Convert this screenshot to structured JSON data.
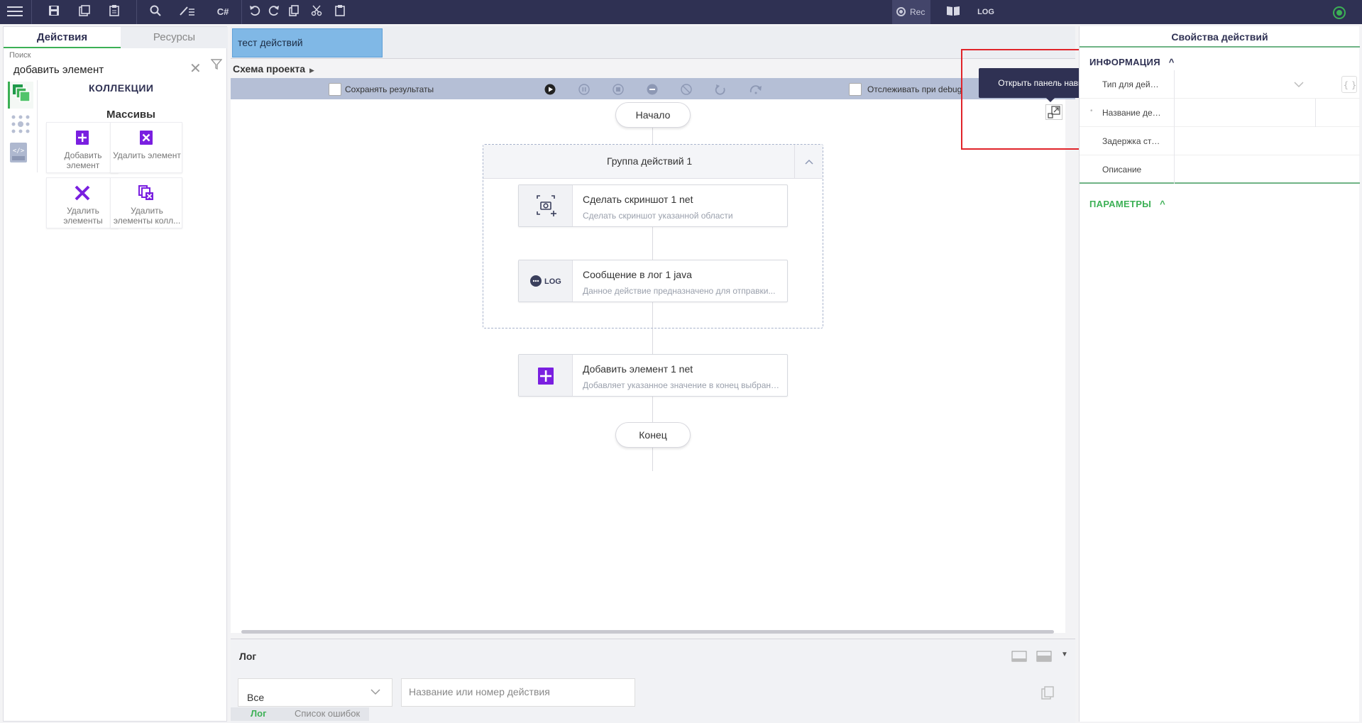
{
  "toolbar": {
    "icons": [
      "menu-icon",
      "save-icon",
      "save-as-icon",
      "clipboard-icon",
      "search-icon",
      "edit-icon",
      "csharp-icon",
      "undo-icon",
      "redo-icon",
      "copy-icon",
      "cut-icon",
      "paste-icon"
    ],
    "csharp_label": "C#",
    "rec_label": "Rec",
    "log_label": "LOG",
    "status_color": "#3cb055"
  },
  "left_panel": {
    "tabs": [
      "Действия",
      "Ресурсы"
    ],
    "search_label": "Поиск",
    "search_value": "добавить элемент",
    "category": "КОЛЛЕКЦИИ",
    "subcategory": "Массивы",
    "actions": [
      {
        "label": "Добавить элемент",
        "icon": "add-element-icon"
      },
      {
        "label": "Удалить элемент",
        "icon": "remove-element-icon"
      },
      {
        "label": "Удалить элементы",
        "icon": "remove-elements-icon"
      },
      {
        "label": "Удалить элементы колл...",
        "icon": "remove-collection-elements-icon"
      }
    ]
  },
  "center": {
    "doc_tab": "тест действий",
    "breadcrumb": "Схема проекта",
    "save_results": "Сохранять результаты",
    "track_debug": "Отслеживать при debug",
    "start": "Начало",
    "end": "Конец",
    "group_title": "Группа действий  1",
    "nodes": [
      {
        "title": "Сделать скриншот  1  net",
        "desc": "Сделать скриншот указанной области",
        "icon": "screenshot-icon"
      },
      {
        "title": "Сообщение в лог  1  java",
        "desc": "Данное действие предназначено для отправки...",
        "icon": "log-message-icon",
        "icon_text": "LOG"
      },
      {
        "title": "Добавить элемент  1  net",
        "desc": "Добавляет указанное значение в конец выбранной коллекции",
        "icon": "add-element-icon"
      }
    ],
    "tooltip": "Открыть панель навигации"
  },
  "log": {
    "title": "Лог",
    "filter_value": "Все",
    "search_placeholder": "Название или номер действия",
    "tabs": [
      "Лог",
      "Список ошибок"
    ]
  },
  "right_panel": {
    "title": "Свойства действий",
    "info_section": "ИНФОРМАЦИЯ",
    "params_section": "ПАРАМЕТРЫ",
    "rows": [
      "Тип для действ...",
      "Название дей...",
      "Задержка ста...",
      "Описание"
    ],
    "accent_color": "#3cb055"
  }
}
